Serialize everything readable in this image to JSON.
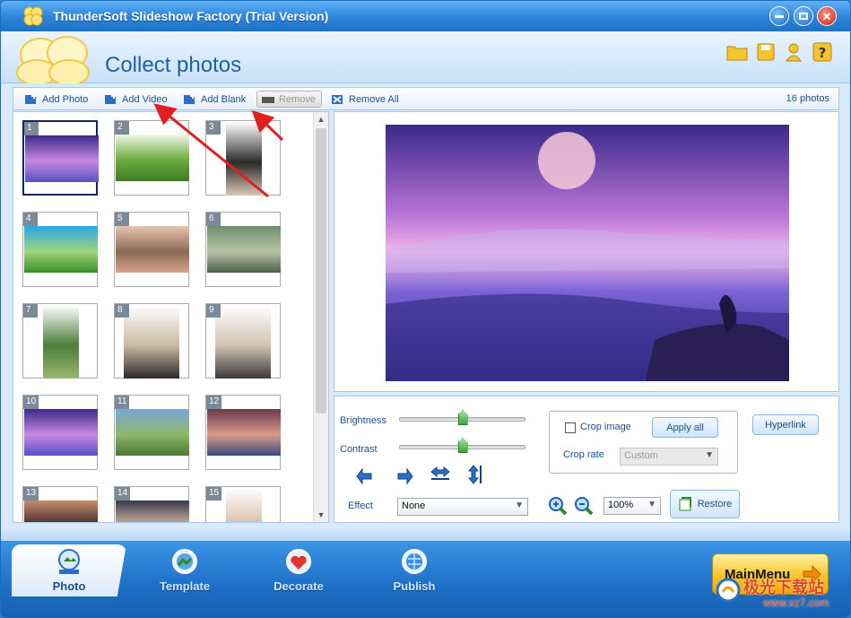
{
  "window": {
    "title": "ThunderSoft Slideshow Factory (Trial Version)"
  },
  "header": {
    "page_title": "Collect photos"
  },
  "toolbar": {
    "add_photo": "Add Photo",
    "add_video": "Add Video",
    "add_blank": "Add Blank",
    "remove": "Remove",
    "remove_all": "Remove All",
    "photo_count": "16 photos"
  },
  "thumbnails": [
    {
      "num": "1"
    },
    {
      "num": "2"
    },
    {
      "num": "3"
    },
    {
      "num": "4"
    },
    {
      "num": "5"
    },
    {
      "num": "6"
    },
    {
      "num": "7"
    },
    {
      "num": "8"
    },
    {
      "num": "9"
    },
    {
      "num": "10"
    },
    {
      "num": "11"
    },
    {
      "num": "12"
    },
    {
      "num": "13"
    },
    {
      "num": "14"
    },
    {
      "num": "15"
    }
  ],
  "edit": {
    "brightness_label": "Brightness",
    "contrast_label": "Contrast",
    "brightness_value": 0.5,
    "contrast_value": 0.5,
    "effect_label": "Effect",
    "effect_value": "None",
    "crop_image_label": "Crop image",
    "apply_all": "Apply all",
    "crop_rate_label": "Crop rate",
    "crop_rate_value": "Custom",
    "hyperlink": "Hyperlink",
    "zoom_value": "100%",
    "restore": "Restore"
  },
  "nav": {
    "photo": "Photo",
    "template": "Template",
    "decorate": "Decorate",
    "publish": "Publish",
    "main_menu": "MainMenu"
  },
  "watermark": {
    "text": "极光下载站",
    "url": "www.xz7.com"
  },
  "colors": {
    "accent": "#2c84d8",
    "selected_border": "#13265e",
    "annotation_arrow": "#e02020"
  }
}
